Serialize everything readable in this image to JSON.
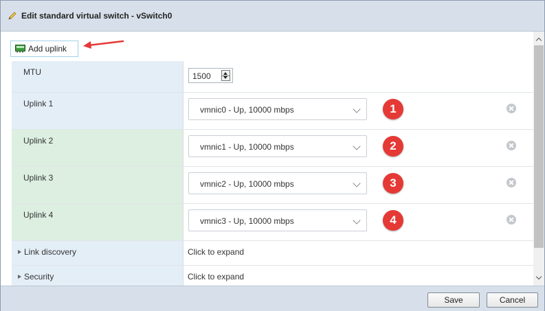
{
  "dialog": {
    "title": "Edit standard virtual switch - vSwitch0",
    "icon": "pencil-icon"
  },
  "toolbar": {
    "add_uplink_label": "Add uplink",
    "add_uplink_icon": "network-card-icon"
  },
  "mtu": {
    "label": "MTU",
    "value": "1500"
  },
  "uplinks": [
    {
      "label": "Uplink 1",
      "selected": "vmnic0 - Up, 10000 mbps",
      "marker": "1"
    },
    {
      "label": "Uplink 2",
      "selected": "vmnic1 - Up, 10000 mbps",
      "marker": "2"
    },
    {
      "label": "Uplink 3",
      "selected": "vmnic2 - Up, 10000 mbps",
      "marker": "3"
    },
    {
      "label": "Uplink 4",
      "selected": "vmnic3 - Up, 10000 mbps",
      "marker": "4"
    }
  ],
  "sections": [
    {
      "label": "Link discovery",
      "value": "Click to expand"
    },
    {
      "label": "Security",
      "value": "Click to expand"
    }
  ],
  "footer": {
    "save_label": "Save",
    "cancel_label": "Cancel"
  },
  "colors": {
    "title_bar": "#d7e0ea",
    "label_blue": "#e4eef7",
    "label_green": "#dcefe1",
    "marker_red": "#e53935"
  }
}
